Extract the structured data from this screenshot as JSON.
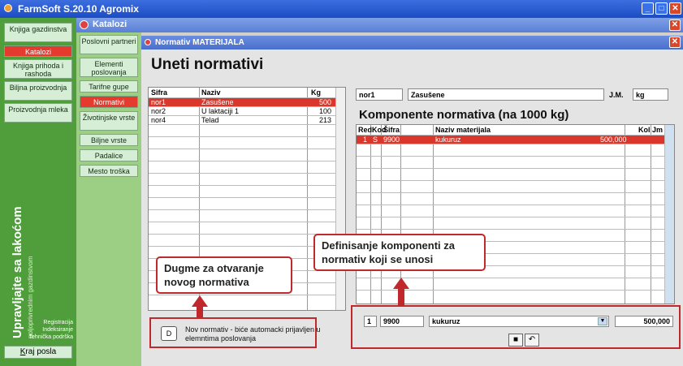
{
  "app": {
    "title": "FarmSoft S.20.10 Agromix"
  },
  "left_nav": {
    "items": [
      {
        "label": "Knjiga gazdinstva",
        "active": false
      },
      {
        "label": "Katalozi",
        "active": true
      },
      {
        "label": "Knjiga prihoda i rashoda",
        "active": false
      },
      {
        "label": "Biljna proizvodnja",
        "active": false
      },
      {
        "label": "Proizvodnja mleka",
        "active": false
      }
    ],
    "slogan": "Upravljajte sa lakoćom",
    "slogan_sub": "poljoprivrednim gazdinstvom",
    "bottom_links": [
      "Registracija",
      "Indeksiranje",
      "Tehnička podrška"
    ],
    "exit_label_underlined": "K",
    "exit_label_rest": "raj posla"
  },
  "katalozi": {
    "title": "Katalozi",
    "items": [
      {
        "label": "Poslovni partneri",
        "active": false
      },
      {
        "label": "Elementi poslovanja",
        "active": false
      },
      {
        "label": "Tarifne gupe",
        "active": false
      },
      {
        "label": "Normativi",
        "active": true
      },
      {
        "label": "Životinjske vrste",
        "active": false
      },
      {
        "label": "Biljne vrste",
        "active": false
      },
      {
        "label": "Padalice",
        "active": false
      },
      {
        "label": "Mesto troška",
        "active": false
      }
    ]
  },
  "normativ": {
    "window_title": "Normativ MATERIJALA",
    "heading": "Uneti normativi",
    "table": {
      "headers": [
        "Sifra",
        "Naziv",
        "Kg"
      ],
      "rows": [
        {
          "sifra": "nor1",
          "naziv": "Zasušene",
          "kg": "500",
          "selected": true
        },
        {
          "sifra": "nor2",
          "naziv": "U laktaciji 1",
          "kg": "100",
          "selected": false
        },
        {
          "sifra": "nor4",
          "naziv": "Telad",
          "kg": "213",
          "selected": false
        }
      ]
    },
    "selected": {
      "code": "nor1",
      "name": "Zasušene",
      "jm_label": "J.M.",
      "jm": "kg"
    },
    "components_heading": "Komponente normativa  (na 1000 kg)",
    "comp_table": {
      "headers": [
        "Red",
        "Kod",
        "Šifra",
        "Naziv materijala",
        "Kol",
        "Jm"
      ],
      "rows": [
        {
          "red": "1",
          "kod": "S",
          "sifra": "9900",
          "naziv": "kukuruz",
          "kol": "500,000",
          "jm": ""
        }
      ]
    },
    "input_row": {
      "red": "1",
      "sifra": "9900",
      "naziv": "kukuruz",
      "kol": "500,000"
    },
    "new_button_label": "D",
    "new_text": "Nov normativ - biće automacki prijavljen u elemntima poslovanja"
  },
  "callouts": {
    "new": "Dugme za otvaranje novog normativa",
    "components": "Definisanje komponenti za normativ koji se unosi"
  },
  "colors": {
    "accent": "#d9372b",
    "green": "#4f9e3b",
    "title_blue": "#1c4cc2"
  }
}
